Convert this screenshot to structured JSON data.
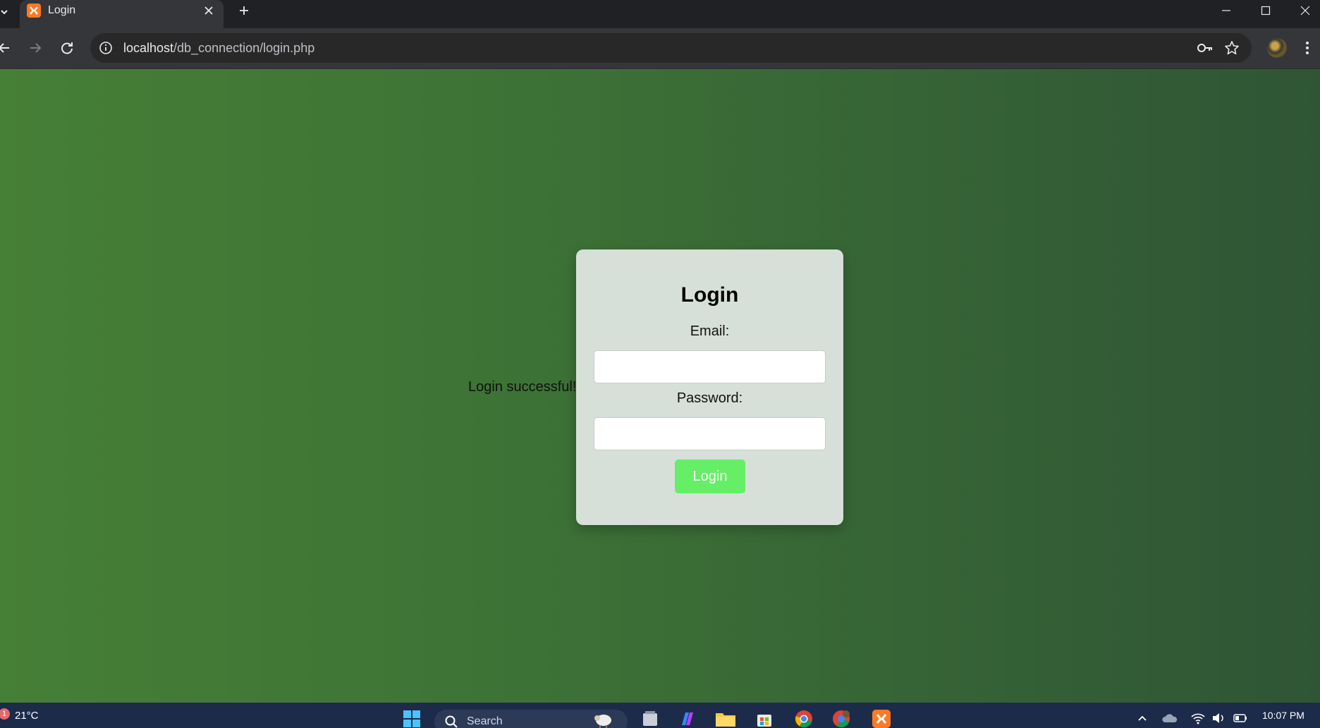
{
  "browser": {
    "tab_title": "Login",
    "url_host": "localhost",
    "url_path": "/db_connection/login.php"
  },
  "page": {
    "status_message": "Login successful!",
    "form": {
      "title": "Login",
      "email_label": "Email:",
      "email_value": "",
      "password_label": "Password:",
      "password_value": "",
      "submit_label": "Login"
    }
  },
  "taskbar": {
    "weather_badge": "1",
    "temperature": "21°C",
    "search_placeholder": "Search",
    "time": "10:07 PM"
  },
  "colors": {
    "background_start": "#467f36",
    "background_end": "#2f5535",
    "card": "#d7e0d8",
    "button": "#66ee66"
  }
}
